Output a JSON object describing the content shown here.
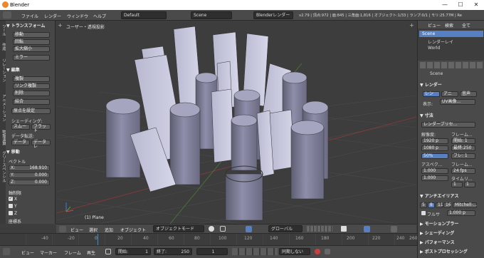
{
  "window": {
    "title": "Blender",
    "min": "—",
    "max": "☐",
    "close": "✕"
  },
  "info": {
    "menus": [
      "ファイル",
      "レンダー",
      "ウィンドウ",
      "ヘルプ"
    ],
    "layout": "Default",
    "scene": "Scene",
    "engine": "Blenderレンダー",
    "stats": "v2.79 | 頂点:972 | 面:845 | 三角面:1,816 | オブジェクト:1/33 | ランプ:0/1 | モリ:25.77M | Re"
  },
  "toolshelf": {
    "tabs": [
      "ツール",
      "作成",
      "リレーション",
      "アニメーション",
      "物理演算",
      "グリースペンシル"
    ],
    "transform_title": "▼ トランスフォーム",
    "transform_buttons": [
      "移動",
      "回転",
      "拡大縮小",
      "ミラー"
    ],
    "edit_title": "▼ 編集",
    "edit_buttons": [
      "複製",
      "リンク複製",
      "削除",
      "結合"
    ],
    "origin_label": "原点を設定",
    "shading_label": "シェーディング:",
    "shading_buttons": [
      "スムー",
      "フラット"
    ],
    "data_label": "データ転送:",
    "data_buttons": [
      "データ",
      "データレ"
    ],
    "move_title": "▼ 移動",
    "vector_label": "ベクトル",
    "vector": [
      {
        "axis": "X:",
        "value": "168.910"
      },
      {
        "axis": "Y:",
        "value": "0.000"
      },
      {
        "axis": "Z:",
        "value": "0.000"
      }
    ],
    "constraint_label": "軸制限",
    "axes": [
      {
        "name": "X",
        "checked": true
      },
      {
        "name": "Y",
        "checked": false
      },
      {
        "name": "Z",
        "checked": false
      }
    ],
    "orient_label": "座標系"
  },
  "viewport": {
    "view_label": "ユーザー・透視投影",
    "object_label": "(1) Plane"
  },
  "vpheader": {
    "items": [
      "ビュー",
      "選択",
      "追加",
      "オブジェクト"
    ],
    "mode": "オブジェクトモード",
    "orientation": "グローバル"
  },
  "timeline": {
    "ticks": [
      "-40",
      "-20",
      "0",
      "20",
      "40",
      "60",
      "80",
      "100",
      "120",
      "140",
      "160",
      "180",
      "200",
      "220",
      "240",
      "260"
    ]
  },
  "tlheader": {
    "items": [
      "ビュー",
      "マーカー",
      "フレーム",
      "再生"
    ],
    "start_label": "開始:",
    "start": "1",
    "end_label": "終了:",
    "end": "250",
    "current": "1",
    "sync": "同期しない"
  },
  "outliner": {
    "menus": [
      "ビュー",
      "検索",
      "全て"
    ],
    "items": [
      "Scene",
      "レンダーレイ",
      "World"
    ]
  },
  "props": {
    "scene_label": "Scene",
    "render_title": "▼ レンダー",
    "render_buttons": [
      "レン",
      "アニ",
      "音声"
    ],
    "display_label": "表示:",
    "display_value": "UV画像...",
    "dims_title": "▼ 寸法",
    "preset": "レンダープリセ...",
    "res_label": "解像度:",
    "frame_range_label": "フレーム...",
    "res_x": "1920 p",
    "res_y": "1080 p",
    "res_pct": "50%",
    "start_f": "開始: 1",
    "end_f": "最終:250",
    "step_f": "フレ: 1",
    "aspect_label": "アスペク...",
    "framerate_label": "フレーム...",
    "aspect_x": "1.000",
    "aspect_y": "1.000",
    "fps": "24 fps",
    "time_label": "タイムリ...",
    "t1": "1",
    "t2": "1",
    "aa_title": "▼ アンチエイリアス",
    "aa_values": [
      "5",
      "8",
      "11",
      "16"
    ],
    "aa_filter": "Mitchell-...",
    "full_label": "フルサ",
    "full_value": "1.000 p",
    "sections": [
      "▶ モーションブラー",
      "▶ シェーディング",
      "▶ パフォーマンス",
      "▶ ポストプロセッシング"
    ]
  },
  "colors": {
    "accent": "#5680c2",
    "cyl": "#9a9ab8"
  }
}
